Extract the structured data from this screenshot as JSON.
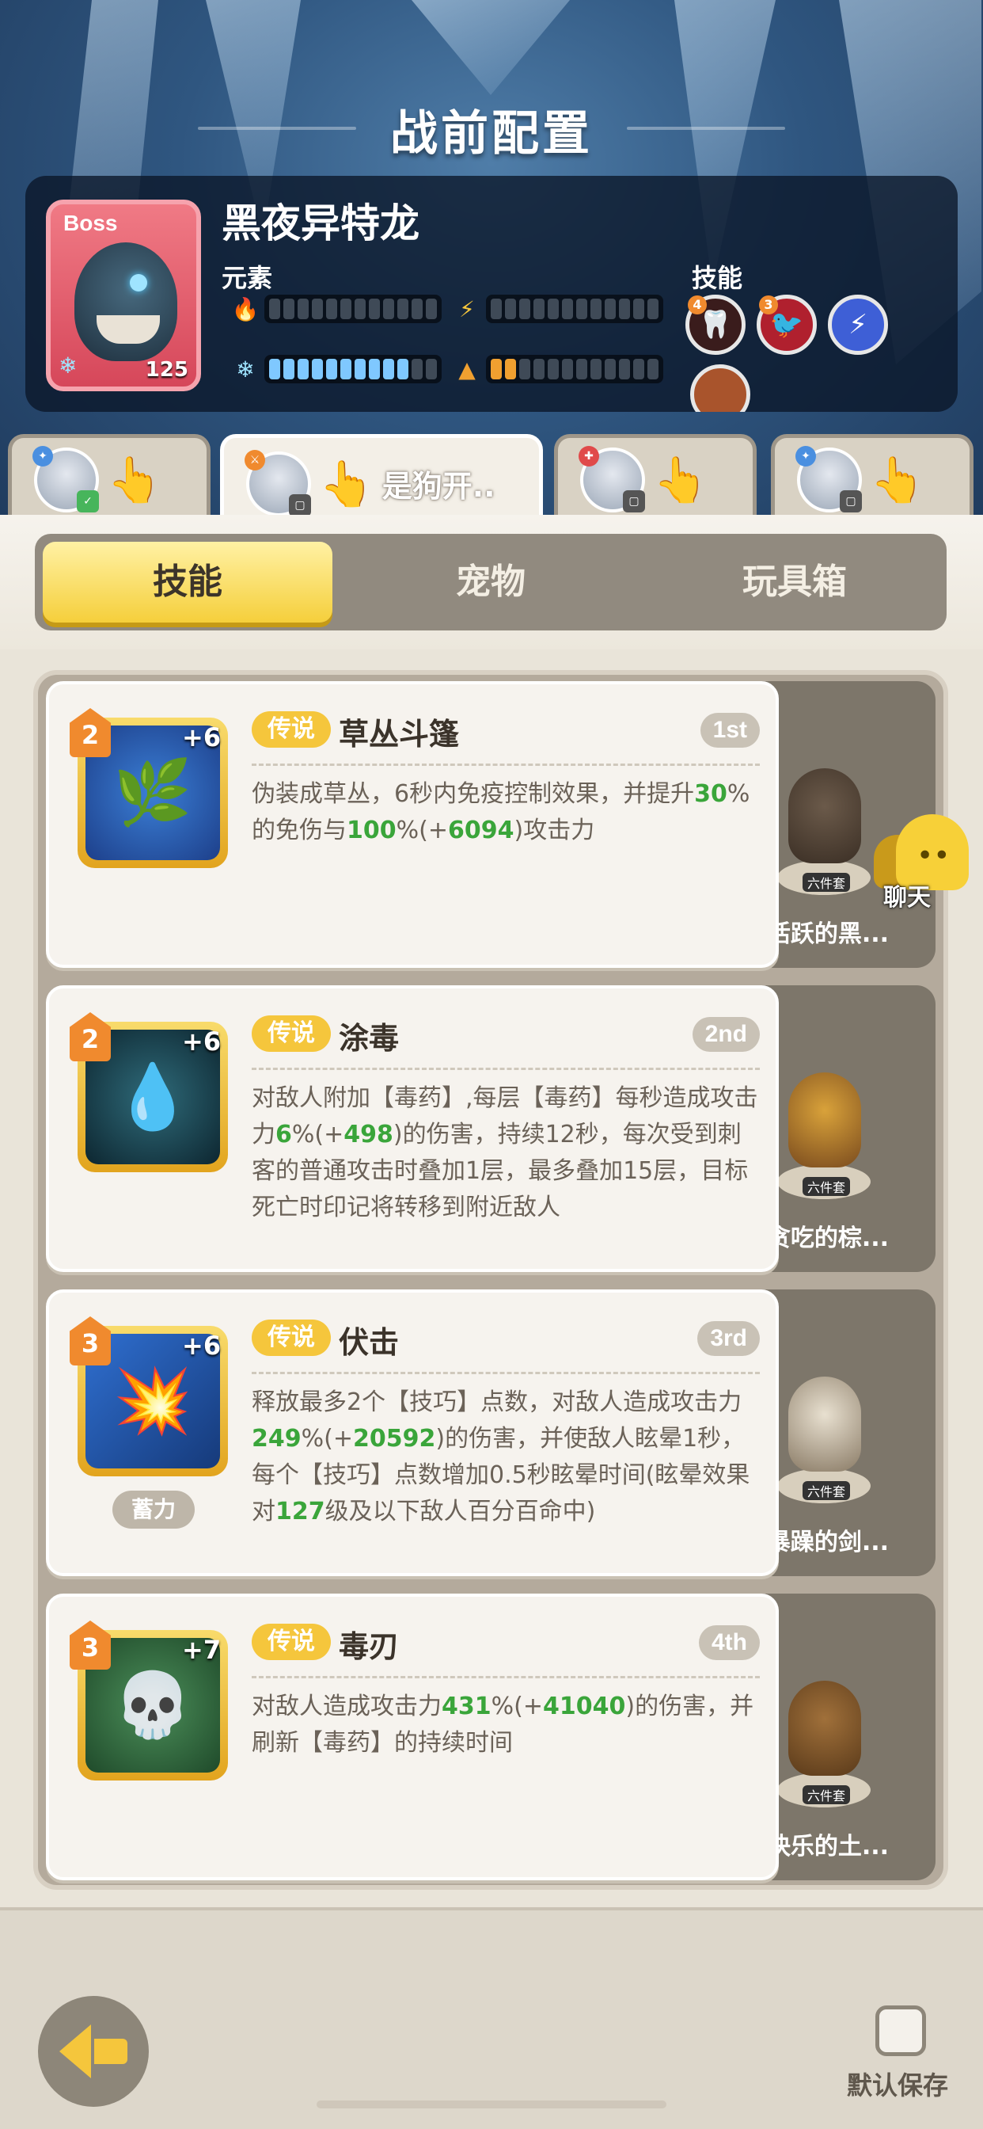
{
  "header": {
    "title": "战前配置"
  },
  "boss": {
    "tag": "Boss",
    "name": "黑夜异特龙",
    "level": "125",
    "element_label": "元素",
    "skills_label": "技能",
    "elements": [
      {
        "icon": "fire-icon",
        "filled": 0,
        "total": 12,
        "color": "#7fc8ff"
      },
      {
        "icon": "lightning-icon",
        "filled": 0,
        "total": 12,
        "color": "#7fc8ff"
      },
      {
        "icon": "ice-icon",
        "filled": 10,
        "total": 12,
        "color": "#7fc8ff"
      },
      {
        "icon": "earth-icon",
        "filled": 2,
        "total": 12,
        "color": "#f0a030"
      }
    ],
    "skill_icons": [
      {
        "name": "fang-skill-icon",
        "badge": "4"
      },
      {
        "name": "bird-skill-icon",
        "badge": "3"
      },
      {
        "name": "lightning-skill-icon",
        "badge": ""
      }
    ]
  },
  "team_tabs": [
    {
      "name": "",
      "active": false
    },
    {
      "name": "是狗开..",
      "active": true
    },
    {
      "name": "",
      "active": false
    },
    {
      "name": "",
      "active": false
    }
  ],
  "segments": [
    {
      "label": "技能",
      "active": true
    },
    {
      "label": "宠物",
      "active": false
    },
    {
      "label": "玩具箱",
      "active": false
    }
  ],
  "skills": [
    {
      "level": "2",
      "plus": "+6",
      "rarity": "传说",
      "name": "草丛斗篷",
      "rank": "1st",
      "charge": "",
      "desc_parts": [
        "伪装成草丛，6秒内免疫控制效果，并提升",
        "30",
        "%的免伤与",
        "100",
        "%(+",
        "6094",
        ")攻击力"
      ],
      "set": {
        "tag": "六件套",
        "name": "活跃的黑..."
      },
      "icon": "bush-icon"
    },
    {
      "level": "2",
      "plus": "+6",
      "rarity": "传说",
      "name": "涂毒",
      "rank": "2nd",
      "charge": "",
      "desc_parts": [
        "对敌人附加【毒药】,每层【毒药】每秒造成攻击力",
        "6",
        "%(+",
        "498",
        ")的伤害，持续12秒，每次受到刺客的普通攻击时叠加1层，最多叠加15层，目标死亡时印记将转移到附近敌人"
      ],
      "set": {
        "tag": "六件套",
        "name": "贪吃的棕..."
      },
      "icon": "poison-drop-icon"
    },
    {
      "level": "3",
      "plus": "+6",
      "rarity": "传说",
      "name": "伏击",
      "rank": "3rd",
      "charge": "蓄力",
      "desc_parts": [
        "释放最多2个【技巧】点数，对敌人造成攻击力",
        "249",
        "%(+",
        "20592",
        ")的伤害，并使敌人眩晕1秒，每个【技巧】点数增加0.5秒眩晕时间(眩晕效果对",
        "127",
        "级及以下敌人百分百命中)"
      ],
      "set": {
        "tag": "六件套",
        "name": "暴躁的剑..."
      },
      "icon": "ambush-icon"
    },
    {
      "level": "3",
      "plus": "+7",
      "rarity": "传说",
      "name": "毒刃",
      "rank": "4th",
      "charge": "",
      "desc_parts": [
        "对敌人造成攻击力",
        "431",
        "%(+",
        "41040",
        ")的伤害，并刷新【毒药】的持续时间"
      ],
      "set": {
        "tag": "六件套",
        "name": "快乐的土..."
      },
      "icon": "skull-icon"
    }
  ],
  "chat": {
    "label": "聊天"
  },
  "footer": {
    "save_label": "默认保存"
  }
}
